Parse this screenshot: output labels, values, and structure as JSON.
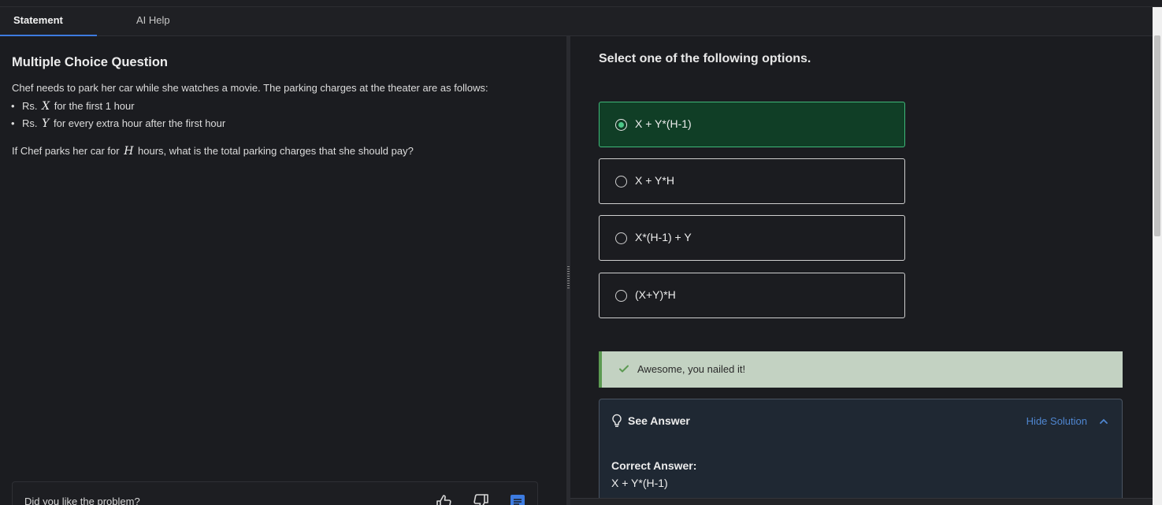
{
  "tabs": [
    {
      "label": "Statement",
      "active": true
    },
    {
      "label": "AI Help",
      "active": false
    }
  ],
  "problem": {
    "title": "Multiple Choice Question",
    "intro": "Chef needs to park her car while she watches a movie. The parking charges at the theater are as follows:",
    "bullets": [
      {
        "prefix": "Rs.",
        "var": "X",
        "suffix": "for the first 1 hour"
      },
      {
        "prefix": "Rs.",
        "var": "Y",
        "suffix": "for every extra hour after the first hour"
      }
    ],
    "question_prefix": "If Chef parks her car for",
    "question_var": "H",
    "question_suffix": "hours, what is the total parking charges that she should pay?"
  },
  "feedback": {
    "label": "Did you like the problem?",
    "icons": [
      "thumbs-up-icon",
      "thumbs-down-icon",
      "comment-icon"
    ]
  },
  "options_panel": {
    "title": "Select one of the following options.",
    "options": [
      {
        "label": "X + Y*(H-1)",
        "selected": true
      },
      {
        "label": "X + Y*H",
        "selected": false
      },
      {
        "label": "X*(H-1) + Y",
        "selected": false
      },
      {
        "label": "(X+Y)*H",
        "selected": false
      }
    ]
  },
  "result": {
    "message": "Awesome, you nailed it!",
    "icon": "check-icon"
  },
  "answer": {
    "heading": "See Answer",
    "toggle_label": "Hide Solution",
    "correct_label": "Correct Answer:",
    "correct_value": "X + Y*(H-1)"
  },
  "colors": {
    "accent": "#3d7be0",
    "selected_bg": "#103e26",
    "selected_border": "#3fb97a",
    "success_bg": "#c3d2c2",
    "link": "#4f86d0"
  }
}
